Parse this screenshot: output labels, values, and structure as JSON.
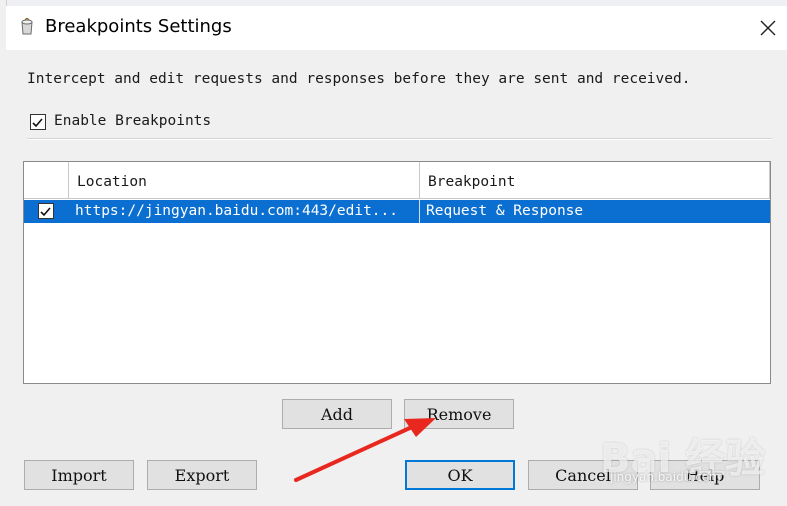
{
  "window": {
    "title": "Breakpoints Settings",
    "close_icon": "close-icon",
    "app_icon": "charles-app-icon"
  },
  "description": "Intercept and edit requests and responses before they are sent and received.",
  "enable": {
    "label": "Enable Breakpoints",
    "checked": true
  },
  "table": {
    "columns": [
      "",
      "Location",
      "Breakpoint"
    ],
    "rows": [
      {
        "checked": true,
        "location": "https://jingyan.baidu.com:443/edit...",
        "breakpoint": "Request & Response",
        "selected": true
      }
    ]
  },
  "buttons": {
    "add": "Add",
    "remove": "Remove",
    "import": "Import",
    "export": "Export",
    "ok": "OK",
    "cancel": "Cancel",
    "help": "Help"
  },
  "watermark": {
    "logo": "Bai 经验",
    "url": "jingyan.baidu.com"
  },
  "colors": {
    "selection": "#0a6fd1",
    "annotation_arrow": "#e8281f",
    "default_button_border": "#0078d7"
  }
}
